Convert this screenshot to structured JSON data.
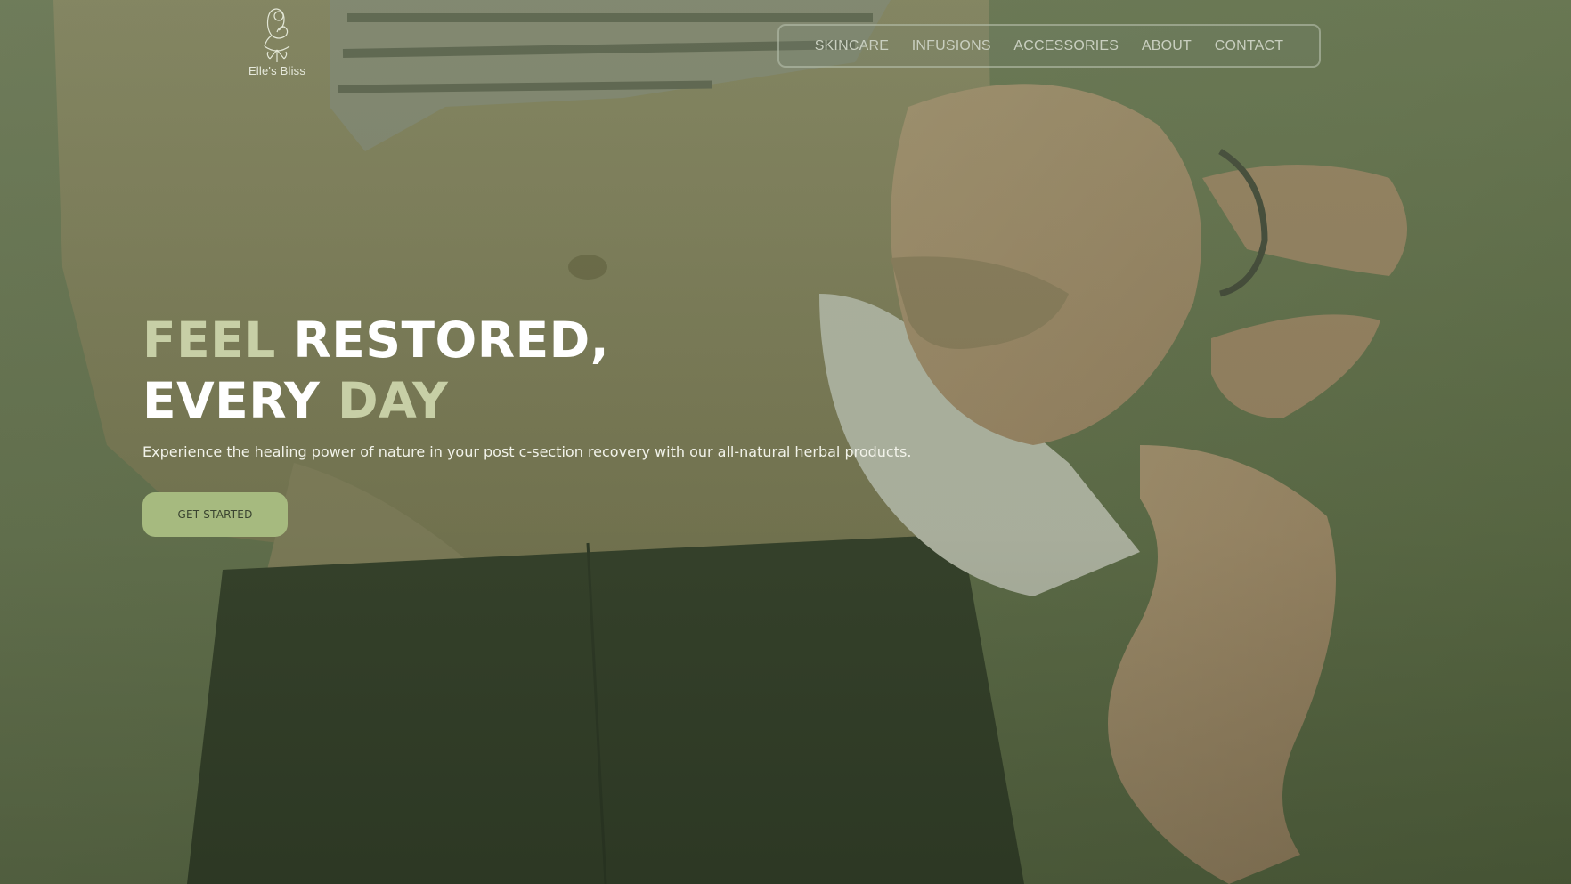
{
  "brand": {
    "logo_icon": "mother-and-baby-leaf-emblem-icon",
    "name": "Elle's Bliss"
  },
  "nav": {
    "items": [
      {
        "label": "SKINCARE"
      },
      {
        "label": "INFUSIONS"
      },
      {
        "label": "ACCESSORIES"
      },
      {
        "label": "ABOUT"
      },
      {
        "label": "CONTACT"
      }
    ]
  },
  "hero": {
    "headline": {
      "line1_word1": "FEEL",
      "line1_word2": "RESTORED,",
      "line2_word1": "EVERY",
      "line2_word2": "DAY"
    },
    "subtitle": "Experience the healing power of nature in your post c-section recovery with our all-natural herbal products.",
    "cta_label": "GET STARTED",
    "background_image": "mother-holding-baby-photo"
  },
  "colors": {
    "overlay_green": "#6e7d5a",
    "accent_text": "#c7cfa6",
    "cta_background": "#a6ba7f",
    "headline_white": "#ffffff"
  }
}
